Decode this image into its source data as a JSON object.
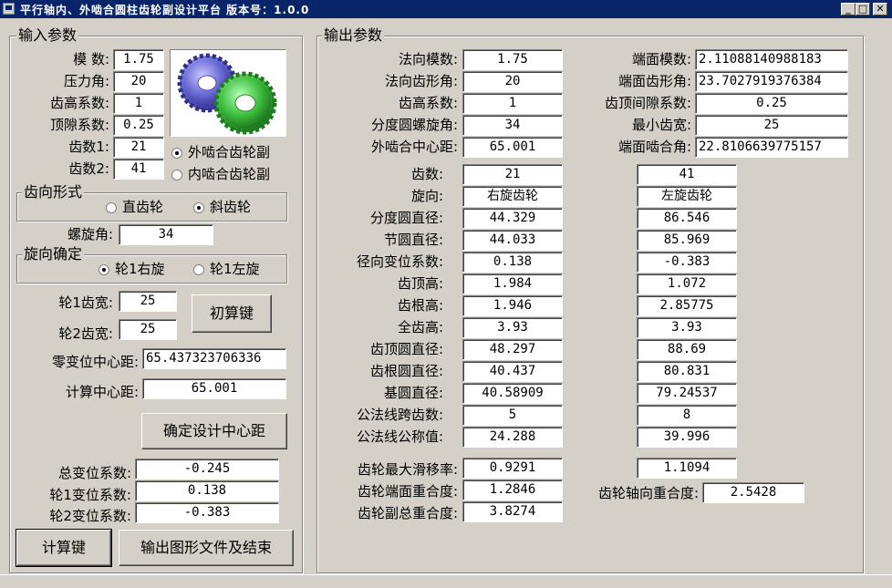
{
  "window": {
    "title": "平行轴内、外啮合圆柱齿轮副设计平台  版本号：1.0.0",
    "min_glyph": "_",
    "max_glyph": "□",
    "close_glyph": "✕"
  },
  "input": {
    "title": "输入参数",
    "module_label": "模    数:",
    "module": "1.75",
    "pressure_angle_label": "压力角:",
    "pressure_angle": "20",
    "addendum_coef_label": "齿高系数:",
    "addendum_coef": "1",
    "clearance_coef_label": "顶隙系数:",
    "clearance_coef": "0.25",
    "z1_label": "齿数1:",
    "z1": "21",
    "z2_label": "齿数2:",
    "z2": "41",
    "mesh_external": "外啮合齿轮副",
    "mesh_internal": "内啮合齿轮副",
    "gear_form_title": "齿向形式",
    "spur": "直齿轮",
    "helical": "斜齿轮",
    "helix_angle_label": "螺旋角:",
    "helix_angle": "34",
    "hand_title": "旋向确定",
    "hand_right": "轮1右旋",
    "hand_left": "轮1左旋",
    "width1_label": "轮1齿宽:",
    "width1": "25",
    "width2_label": "轮2齿宽:",
    "width2": "25",
    "initial_calc_button": "初算键",
    "zero_shift_center_label": "零变位中心距:",
    "zero_shift_center": "65.437323706336",
    "calc_center_label": "计算中心距:",
    "calc_center": "65.001",
    "confirm_center_button": "确定设计中心距",
    "total_shift_label": "总变位系数:",
    "total_shift": "-0.245",
    "shift1_label": "轮1变位系数:",
    "shift1": "0.138",
    "shift2_label": "轮2变位系数:",
    "shift2": "-0.383",
    "calc_button": "计算键",
    "export_button": "输出图形文件及结束"
  },
  "output": {
    "title": "输出参数",
    "normal_module_label": "法向模数:",
    "normal_module": "1.75",
    "normal_pressure_label": "法向齿形角:",
    "normal_pressure": "20",
    "addendum_coef_label": "齿高系数:",
    "addendum_coef": "1",
    "helix_label": "分度圆螺旋角:",
    "helix": "34",
    "center_label": "外啮合中心距:",
    "center": "65.001",
    "transverse_module_label": "端面模数:",
    "transverse_module": "2.11088140988183",
    "transverse_pressure_label": "端面齿形角:",
    "transverse_pressure": "23.7027919376384",
    "tip_clearance_label": "齿顶间隙系数:",
    "tip_clearance": "0.25",
    "min_width_label": "最小齿宽:",
    "min_width": "25",
    "transverse_mesh_label": "端面啮合角:",
    "transverse_mesh": "22.8106639775157",
    "rows": [
      {
        "label": "齿数:",
        "g1": "21",
        "g2": "41"
      },
      {
        "label": "旋向:",
        "g1": "右旋齿轮",
        "g2": "左旋齿轮"
      },
      {
        "label": "分度圆直径:",
        "g1": "44.329",
        "g2": "86.546"
      },
      {
        "label": "节圆直径:",
        "g1": "44.033",
        "g2": "85.969"
      },
      {
        "label": "径向变位系数:",
        "g1": "0.138",
        "g2": "-0.383"
      },
      {
        "label": "齿顶高:",
        "g1": "1.984",
        "g2": "1.072"
      },
      {
        "label": "齿根高:",
        "g1": "1.946",
        "g2": "2.85775"
      },
      {
        "label": "全齿高:",
        "g1": "3.93",
        "g2": "3.93"
      },
      {
        "label": "齿顶圆直径:",
        "g1": "48.297",
        "g2": "88.69"
      },
      {
        "label": "齿根圆直径:",
        "g1": "40.437",
        "g2": "80.831"
      },
      {
        "label": "基圆直径:",
        "g1": "40.58909",
        "g2": "79.24537"
      },
      {
        "label": "公法线跨齿数:",
        "g1": "5",
        "g2": "8"
      },
      {
        "label": "公法线公称值:",
        "g1": "24.288",
        "g2": "39.996"
      }
    ],
    "max_slide_label": "齿轮最大滑移率:",
    "max_slide1": "0.9291",
    "max_slide2": "1.1094",
    "transverse_overlap_label": "齿轮端面重合度:",
    "transverse_overlap": "1.2846",
    "axial_overlap_label": "齿轮轴向重合度:",
    "axial_overlap": "2.5428",
    "total_overlap_label": "齿轮副总重合度:",
    "total_overlap": "3.8274"
  },
  "colors": {
    "title_bar": "#0a246a",
    "face": "#d4d0c8",
    "gear_blue": "#6b6bd6",
    "gear_green": "#3fbf3f"
  }
}
